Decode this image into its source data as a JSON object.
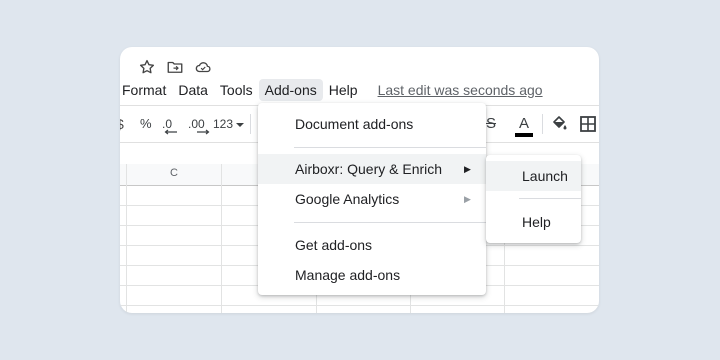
{
  "menubar": {
    "items": [
      {
        "label": "Format"
      },
      {
        "label": "Data"
      },
      {
        "label": "Tools"
      },
      {
        "label": "Add-ons"
      },
      {
        "label": "Help"
      }
    ],
    "last_edit": "Last edit was seconds ago"
  },
  "toolbar": {
    "partial_glyph": "$",
    "percent": "%",
    "decrease_decimal": ".0",
    "increase_decimal": ".00",
    "number_format": "123",
    "strikethrough": "S",
    "text_color": "A",
    "text_color_bar": "#000000",
    "icons": [
      "star-icon",
      "move-to-folder-icon",
      "cloud-saved-icon",
      "fill-color-icon",
      "borders-icon"
    ]
  },
  "grid": {
    "column_headers": [
      "C"
    ]
  },
  "addons_menu": {
    "items": [
      {
        "label": "Document add-ons"
      },
      {
        "label": "Airboxr: Query & Enrich",
        "has_submenu": true
      },
      {
        "label": "Google Analytics",
        "has_submenu": true
      },
      {
        "label": "Get add-ons"
      },
      {
        "label": "Manage add-ons"
      }
    ],
    "arrow": "▶"
  },
  "submenu": {
    "items": [
      {
        "label": "Launch"
      },
      {
        "label": "Help"
      }
    ]
  }
}
